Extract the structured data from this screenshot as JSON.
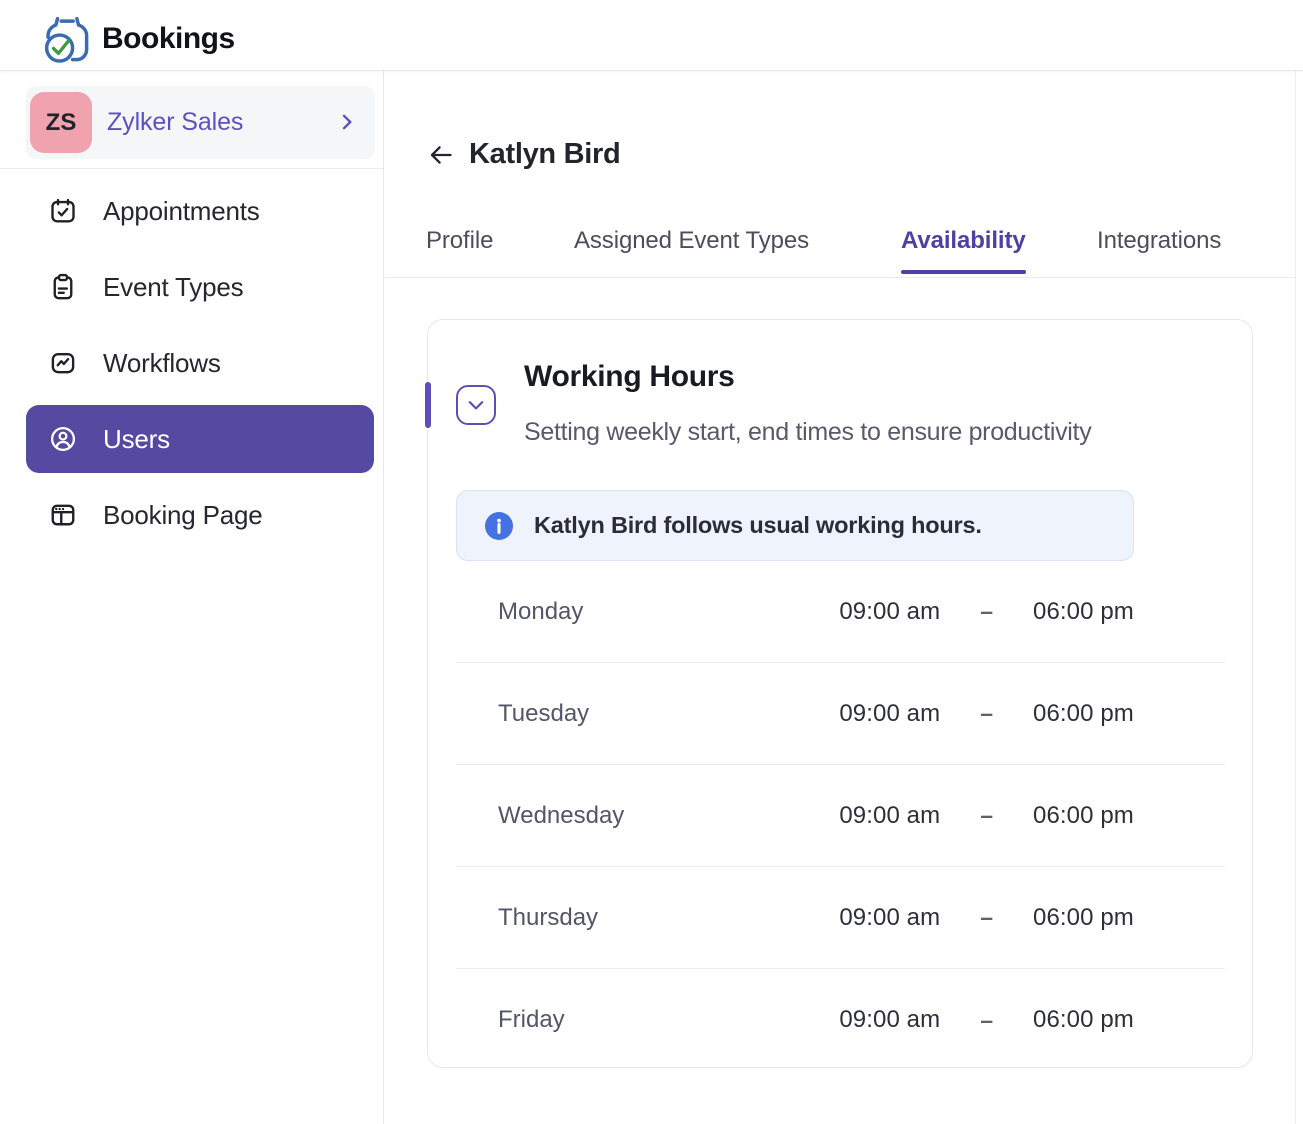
{
  "app": {
    "name": "Bookings"
  },
  "colors": {
    "brand_purple": "#5549a2",
    "accent_purple": "#5c50b4",
    "tab_active_purple": "#4c42a3",
    "account_purple": "#5a52c4",
    "avatar_pink": "#f0a3af",
    "banner_blue_bg": "#eef3fc",
    "info_icon_blue": "#4472e3",
    "logo_blue": "#3a6ab5",
    "logo_green": "#3f9e48"
  },
  "sidebar": {
    "account": {
      "initials": "ZS",
      "name": "Zylker Sales"
    },
    "items": [
      {
        "label": "Appointments",
        "icon": "calendar-check-icon",
        "active": false
      },
      {
        "label": "Event Types",
        "icon": "clipboard-icon",
        "active": false
      },
      {
        "label": "Workflows",
        "icon": "workflow-icon",
        "active": false
      },
      {
        "label": "Users",
        "icon": "user-circle-icon",
        "active": true
      },
      {
        "label": "Booking Page",
        "icon": "layout-icon",
        "active": false
      }
    ]
  },
  "main": {
    "title": "Katlyn Bird",
    "tabs": [
      {
        "label": "Profile",
        "active": false
      },
      {
        "label": "Assigned Event Types",
        "active": false
      },
      {
        "label": "Availability",
        "active": true
      },
      {
        "label": "Integrations",
        "active": false
      }
    ],
    "section": {
      "title": "Working Hours",
      "subtitle": "Setting weekly start, end times to ensure productivity",
      "notice": "Katlyn Bird follows usual working hours.",
      "time_separator": "–",
      "schedule": [
        {
          "day": "Monday",
          "start": "09:00 am",
          "end": "06:00 pm"
        },
        {
          "day": "Tuesday",
          "start": "09:00 am",
          "end": "06:00 pm"
        },
        {
          "day": "Wednesday",
          "start": "09:00 am",
          "end": "06:00 pm"
        },
        {
          "day": "Thursday",
          "start": "09:00 am",
          "end": "06:00 pm"
        },
        {
          "day": "Friday",
          "start": "09:00 am",
          "end": "06:00 pm"
        }
      ]
    }
  }
}
